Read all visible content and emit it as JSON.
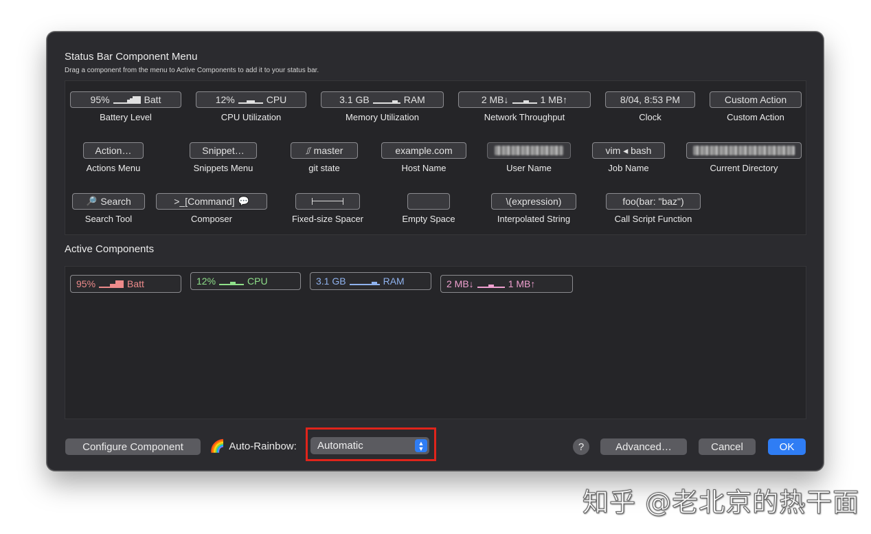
{
  "window": {
    "menu_title": "Status Bar Component Menu",
    "menu_subtitle": "Drag a component from the menu to Active Components to add it to your status bar.",
    "active_title": "Active Components"
  },
  "components": {
    "battery": {
      "pct": "95%",
      "unit": "Batt",
      "label": "Battery Level"
    },
    "cpu": {
      "pct": "12%",
      "unit": "CPU",
      "label": "CPU Utilization"
    },
    "memory": {
      "value": "3.1 GB",
      "unit": "RAM",
      "label": "Memory Utilization"
    },
    "network": {
      "down": "2 MB↓",
      "up": "1 MB↑",
      "label": "Network Throughput"
    },
    "clock": {
      "value": "8/04, 8:53 PM",
      "label": "Clock"
    },
    "custom_action": {
      "value": "Custom Action",
      "label": "Custom Action"
    },
    "actions_menu": {
      "value": "Action…",
      "label": "Actions Menu"
    },
    "snippets_menu": {
      "value": "Snippet…",
      "label": "Snippets Menu"
    },
    "git_state": {
      "value": "master",
      "label": "git state"
    },
    "host_name": {
      "value": "example.com",
      "label": "Host Name"
    },
    "user_name": {
      "label": "User Name"
    },
    "job_name": {
      "value": "vim ◂ bash",
      "label": "Job Name"
    },
    "current_directory": {
      "label": "Current Directory"
    },
    "search_tool": {
      "value": "Search",
      "label": "Search Tool"
    },
    "composer": {
      "value": ">_[Command]",
      "label": "Composer"
    },
    "fixed_spacer": {
      "label": "Fixed-size Spacer"
    },
    "empty_space": {
      "label": "Empty Space"
    },
    "interpolated": {
      "value": "\\(expression)",
      "label": "Interpolated String"
    },
    "call_script": {
      "value": "foo(bar: \"baz\")",
      "label": "Call Script Function"
    }
  },
  "active": {
    "battery": {
      "pct": "95%",
      "unit": "Batt",
      "color": "#ee8b8b"
    },
    "cpu": {
      "pct": "12%",
      "unit": "CPU",
      "color": "#8fe08a"
    },
    "memory": {
      "value": "3.1 GB",
      "unit": "RAM",
      "color": "#8fb2ee"
    },
    "network": {
      "down": "2 MB↓",
      "up": "1 MB↑",
      "color": "#f0a0d0"
    }
  },
  "footer": {
    "configure": "Configure Component",
    "rainbow_label": "Auto-Rainbow:",
    "rainbow_value": "Automatic",
    "help": "?",
    "advanced": "Advanced…",
    "cancel": "Cancel",
    "ok": "OK"
  },
  "watermark": "知乎 @老北京的热干面",
  "colors": {
    "accent": "#2f7df4",
    "highlight": "#e0241b"
  }
}
